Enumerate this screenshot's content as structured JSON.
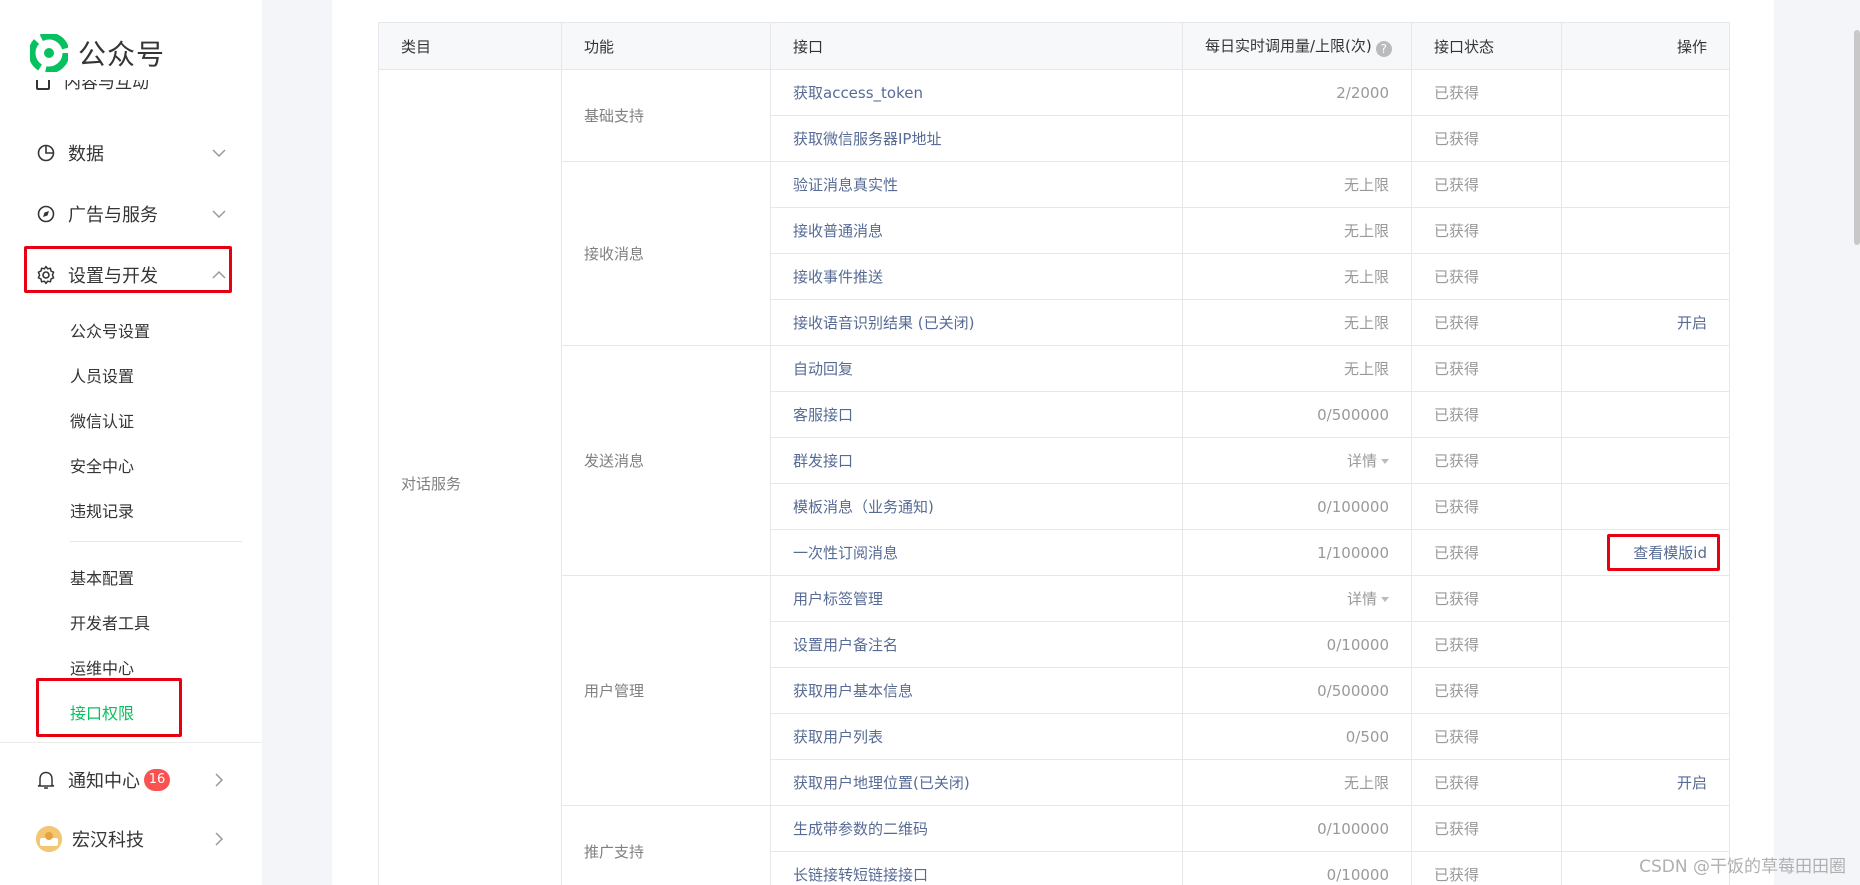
{
  "logo": {
    "text": "公众号"
  },
  "sidebar": {
    "cut_item": "内容与互动",
    "nav": [
      {
        "label": "数据",
        "icon": "pie-chart-icon"
      },
      {
        "label": "广告与服务",
        "icon": "compass-icon"
      },
      {
        "label": "设置与开发",
        "icon": "gear-icon",
        "expanded": true
      }
    ],
    "sub_group1": [
      "公众号设置",
      "人员设置",
      "微信认证",
      "安全中心",
      "违规记录"
    ],
    "sub_group2": [
      "基本配置",
      "开发者工具",
      "运维中心",
      "接口权限"
    ],
    "active_sub": "接口权限",
    "notifications": {
      "label": "通知中心",
      "count": "16"
    },
    "account": {
      "label": "宏汉科技"
    }
  },
  "table": {
    "headers": {
      "category": "类目",
      "function": "功能",
      "interface": "接口",
      "quota": "每日实时调用量/上限(次)",
      "status": "接口状态",
      "action": "操作"
    },
    "category_label": "对话服务",
    "groups": [
      {
        "function": "基础支持",
        "rows": [
          {
            "iface": "获取access_token",
            "quota": "2/2000",
            "status": "已获得",
            "op": ""
          },
          {
            "iface": "获取微信服务器IP地址",
            "quota": "",
            "status": "已获得",
            "op": ""
          }
        ]
      },
      {
        "function": "接收消息",
        "rows": [
          {
            "iface": "验证消息真实性",
            "quota": "无上限",
            "status": "已获得",
            "op": ""
          },
          {
            "iface": "接收普通消息",
            "quota": "无上限",
            "status": "已获得",
            "op": ""
          },
          {
            "iface": "接收事件推送",
            "quota": "无上限",
            "status": "已获得",
            "op": ""
          },
          {
            "iface": "接收语音识别结果 (已关闭)",
            "quota": "无上限",
            "status": "已获得",
            "op": "开启"
          }
        ]
      },
      {
        "function": "发送消息",
        "rows": [
          {
            "iface": "自动回复",
            "quota": "无上限",
            "status": "已获得",
            "op": ""
          },
          {
            "iface": "客服接口",
            "quota": "0/500000",
            "status": "已获得",
            "op": ""
          },
          {
            "iface": "群发接口",
            "quota": "详情",
            "quota_dropdown": true,
            "status": "已获得",
            "op": ""
          },
          {
            "iface": "模板消息（业务通知)",
            "quota": "0/100000",
            "status": "已获得",
            "op": ""
          },
          {
            "iface": "一次性订阅消息",
            "quota": "1/100000",
            "status": "已获得",
            "op": "查看模版id"
          }
        ]
      },
      {
        "function": "用户管理",
        "rows": [
          {
            "iface": "用户标签管理",
            "quota": "详情",
            "quota_dropdown": true,
            "status": "已获得",
            "op": ""
          },
          {
            "iface": "设置用户备注名",
            "quota": "0/10000",
            "status": "已获得",
            "op": ""
          },
          {
            "iface": "获取用户基本信息",
            "quota": "0/500000",
            "status": "已获得",
            "op": ""
          },
          {
            "iface": "获取用户列表",
            "quota": "0/500",
            "status": "已获得",
            "op": ""
          },
          {
            "iface": "获取用户地理位置(已关闭)",
            "quota": "无上限",
            "status": "已获得",
            "op": "开启"
          }
        ]
      },
      {
        "function": "推广支持",
        "rows": [
          {
            "iface": "生成带参数的二维码",
            "quota": "0/100000",
            "status": "已获得",
            "op": ""
          },
          {
            "iface": "长链接转短链接接口",
            "quota": "0/10000",
            "status": "已获得",
            "op": ""
          }
        ]
      }
    ]
  },
  "watermark": "CSDN @干饭的草莓田田圈",
  "colors": {
    "accent": "#07c160",
    "link": "#576b95",
    "highlight": "#e60012",
    "badge": "#fa5151"
  }
}
